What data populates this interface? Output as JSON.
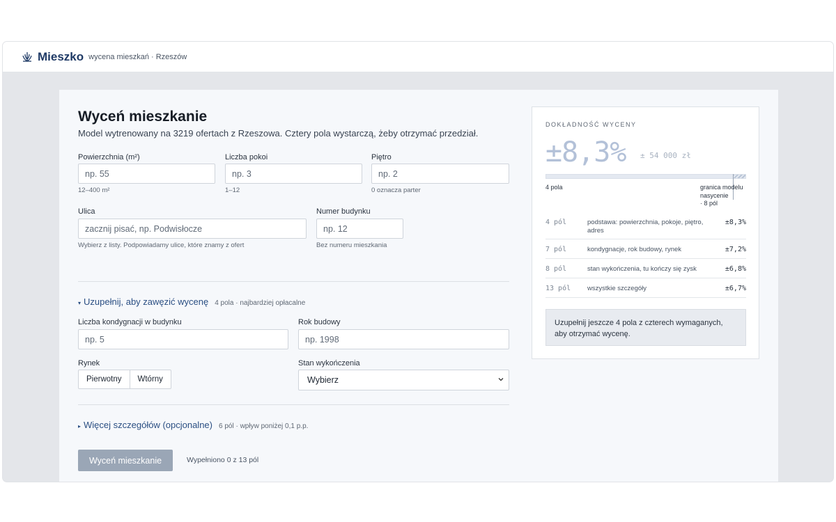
{
  "header": {
    "brand": "Mieszko",
    "tagline": "wycena mieszkań · Rzeszów"
  },
  "form": {
    "title": "Wyceń mieszkanie",
    "subtitle": "Model wytrenowany na 3219 ofertach z Rzeszowa. Cztery pola wystarczą, żeby otrzymać przedział.",
    "area": {
      "label": "Powierzchnia (m²)",
      "placeholder": "np. 55",
      "hint": "12–400 m²"
    },
    "rooms": {
      "label": "Liczba pokoi",
      "placeholder": "np. 3",
      "hint": "1–12"
    },
    "floor": {
      "label": "Piętro",
      "placeholder": "np. 2",
      "hint": "0 oznacza parter"
    },
    "street": {
      "label": "Ulica",
      "placeholder": "zacznij pisać, np. Podwisłocze",
      "hint": "Wybierz z listy. Podpowiadamy ulice, które znamy z ofert"
    },
    "building_no": {
      "label": "Numer budynku",
      "placeholder": "np. 12",
      "hint": "Bez numeru mieszkania"
    },
    "section_narrow": {
      "title": "Uzupełnij, aby zawęzić wycenę",
      "note": "4 pola · najbardziej opłacalne"
    },
    "storeys": {
      "label": "Liczba kondygnacji w budynku",
      "placeholder": "np. 5"
    },
    "year": {
      "label": "Rok budowy",
      "placeholder": "np. 1998"
    },
    "market": {
      "label": "Rynek",
      "options": [
        "Pierwotny",
        "Wtórny"
      ]
    },
    "finish": {
      "label": "Stan wykończenia",
      "value": "Wybierz"
    },
    "section_more": {
      "title": "Więcej szczegółów (opcjonalne)",
      "note": "6 pól · wpływ poniżej 0,1 p.p."
    },
    "submit_label": "Wyceń mieszkanie",
    "filled_text": "Wypełniono 0 z 13 pól"
  },
  "accuracy": {
    "title": "DOKŁADNOŚĆ WYCENY",
    "big_value": "±8,3%",
    "amount": "± 54 000 zł",
    "bar_left": "4 pola",
    "bar_right_1": "granica modelu",
    "bar_right_2": "nasycenie",
    "bar_right_3": "· 8 pól",
    "rows": [
      {
        "n": "4 pól",
        "d": "podstawa: powierzchnia, pokoje, piętro, adres",
        "v": "±8,3%"
      },
      {
        "n": "7 pól",
        "d": "kondygnacje, rok budowy, rynek",
        "v": "±7,2%"
      },
      {
        "n": "8 pól",
        "d": "stan wykończenia, tu kończy się zysk",
        "v": "±6,8%"
      },
      {
        "n": "13 pól",
        "d": "wszystkie szczegóły",
        "v": "±6,7%"
      }
    ],
    "info": "Uzupełnij jeszcze 4 pola z czterech wymaganych, aby otrzymać wycenę."
  }
}
